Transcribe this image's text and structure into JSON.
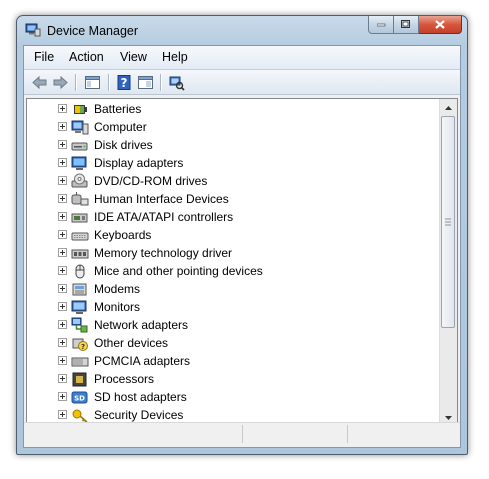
{
  "window": {
    "title": "Device Manager"
  },
  "menu": [
    {
      "label": "File"
    },
    {
      "label": "Action"
    },
    {
      "label": "View"
    },
    {
      "label": "Help"
    }
  ],
  "toolbar": {
    "buttons": [
      "back-icon",
      "forward-icon",
      "show-hide-tree-icon",
      "help-icon",
      "properties-icon",
      "scan-hardware-icon"
    ]
  },
  "tree": {
    "categories": [
      {
        "label": "Batteries",
        "icon": "battery-icon"
      },
      {
        "label": "Computer",
        "icon": "computer-icon"
      },
      {
        "label": "Disk drives",
        "icon": "disk-drive-icon"
      },
      {
        "label": "Display adapters",
        "icon": "display-adapter-icon"
      },
      {
        "label": "DVD/CD-ROM drives",
        "icon": "dvd-drive-icon"
      },
      {
        "label": "Human Interface Devices",
        "icon": "hid-icon"
      },
      {
        "label": "IDE ATA/ATAPI controllers",
        "icon": "ide-controller-icon"
      },
      {
        "label": "Keyboards",
        "icon": "keyboard-icon"
      },
      {
        "label": "Memory technology driver",
        "icon": "memory-icon"
      },
      {
        "label": "Mice and other pointing devices",
        "icon": "mouse-icon"
      },
      {
        "label": "Modems",
        "icon": "modem-icon"
      },
      {
        "label": "Monitors",
        "icon": "monitor-icon"
      },
      {
        "label": "Network adapters",
        "icon": "network-adapter-icon"
      },
      {
        "label": "Other devices",
        "icon": "other-devices-icon"
      },
      {
        "label": "PCMCIA adapters",
        "icon": "pcmcia-icon"
      },
      {
        "label": "Processors",
        "icon": "processor-icon"
      },
      {
        "label": "SD host adapters",
        "icon": "sd-host-icon"
      },
      {
        "label": "Security Devices",
        "icon": "security-device-icon"
      }
    ]
  },
  "colors": {
    "title_bar": "#b9cfe3",
    "close_button": "#c94a33",
    "client_background": "#f0f0f0",
    "tree_background": "#ffffff"
  }
}
